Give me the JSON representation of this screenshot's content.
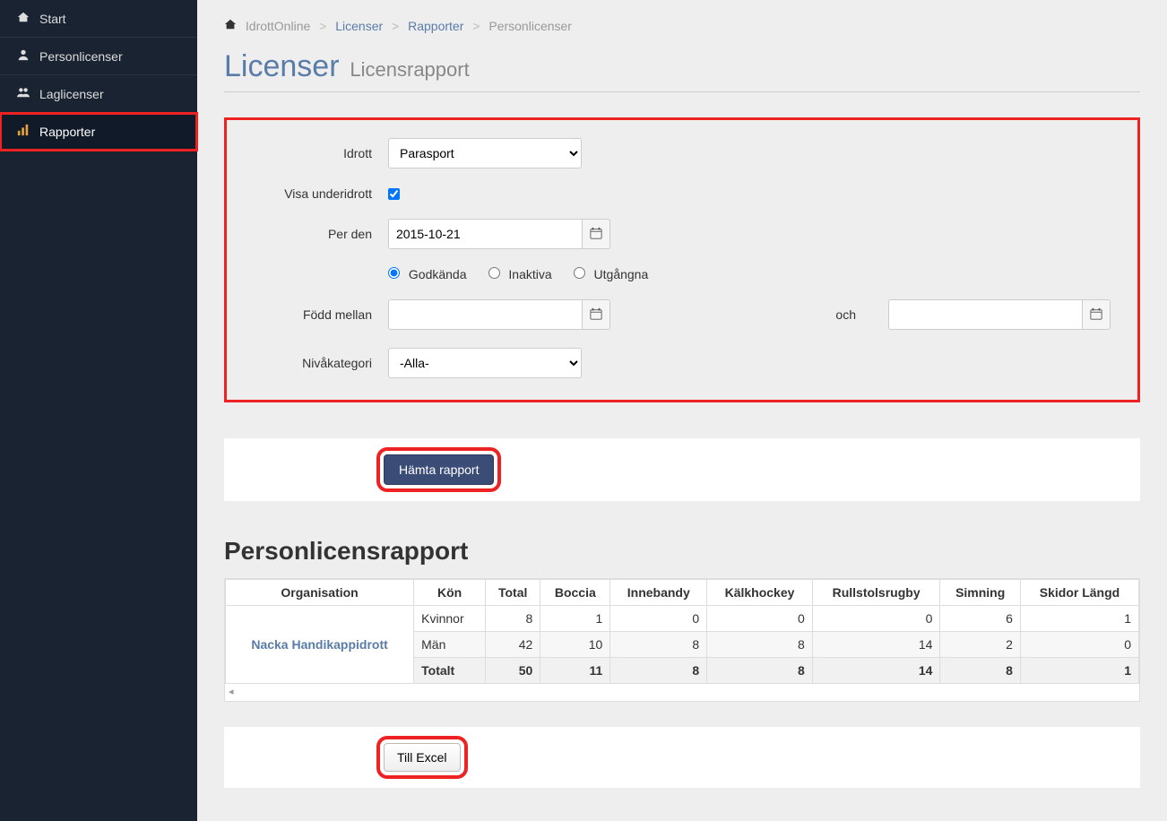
{
  "sidebar": {
    "items": [
      {
        "label": "Start",
        "icon": "home-icon"
      },
      {
        "label": "Personlicenser",
        "icon": "user-icon"
      },
      {
        "label": "Laglicenser",
        "icon": "users-icon"
      },
      {
        "label": "Rapporter",
        "icon": "chart-icon"
      }
    ]
  },
  "breadcrumb": {
    "root": "IdrottOnline",
    "items": [
      "Licenser",
      "Rapporter",
      "Personlicenser"
    ]
  },
  "page": {
    "title": "Licenser",
    "subtitle": "Licensrapport"
  },
  "form": {
    "sport_label": "Idrott",
    "sport_value": "Parasport",
    "show_sub_label": "Visa underidrott",
    "show_sub_checked": true,
    "per_date_label": "Per den",
    "per_date_value": "2015-10-21",
    "status_options": {
      "approved": "Godkända",
      "inactive": "Inaktiva",
      "expired": "Utgångna"
    },
    "status_selected": "approved",
    "born_between_label": "Född mellan",
    "born_from": "",
    "and_label": "och",
    "born_to": "",
    "level_label": "Nivåkategori",
    "level_value": "-Alla-"
  },
  "actions": {
    "fetch_report": "Hämta rapport",
    "to_excel": "Till Excel"
  },
  "report": {
    "title": "Personlicensrapport",
    "columns": [
      "Organisation",
      "Kön",
      "Total",
      "Boccia",
      "Innebandy",
      "Kälkhockey",
      "Rullstolsrugby",
      "Simning",
      "Skidor Längd"
    ],
    "org": "Nacka Handikappidrott",
    "rows": [
      {
        "gender": "Kvinnor",
        "values": [
          8,
          1,
          0,
          0,
          0,
          6,
          1
        ]
      },
      {
        "gender": "Män",
        "values": [
          42,
          10,
          8,
          8,
          14,
          2,
          0
        ]
      }
    ],
    "totals": {
      "label": "Totalt",
      "values": [
        50,
        11,
        8,
        8,
        14,
        8,
        1
      ]
    }
  }
}
